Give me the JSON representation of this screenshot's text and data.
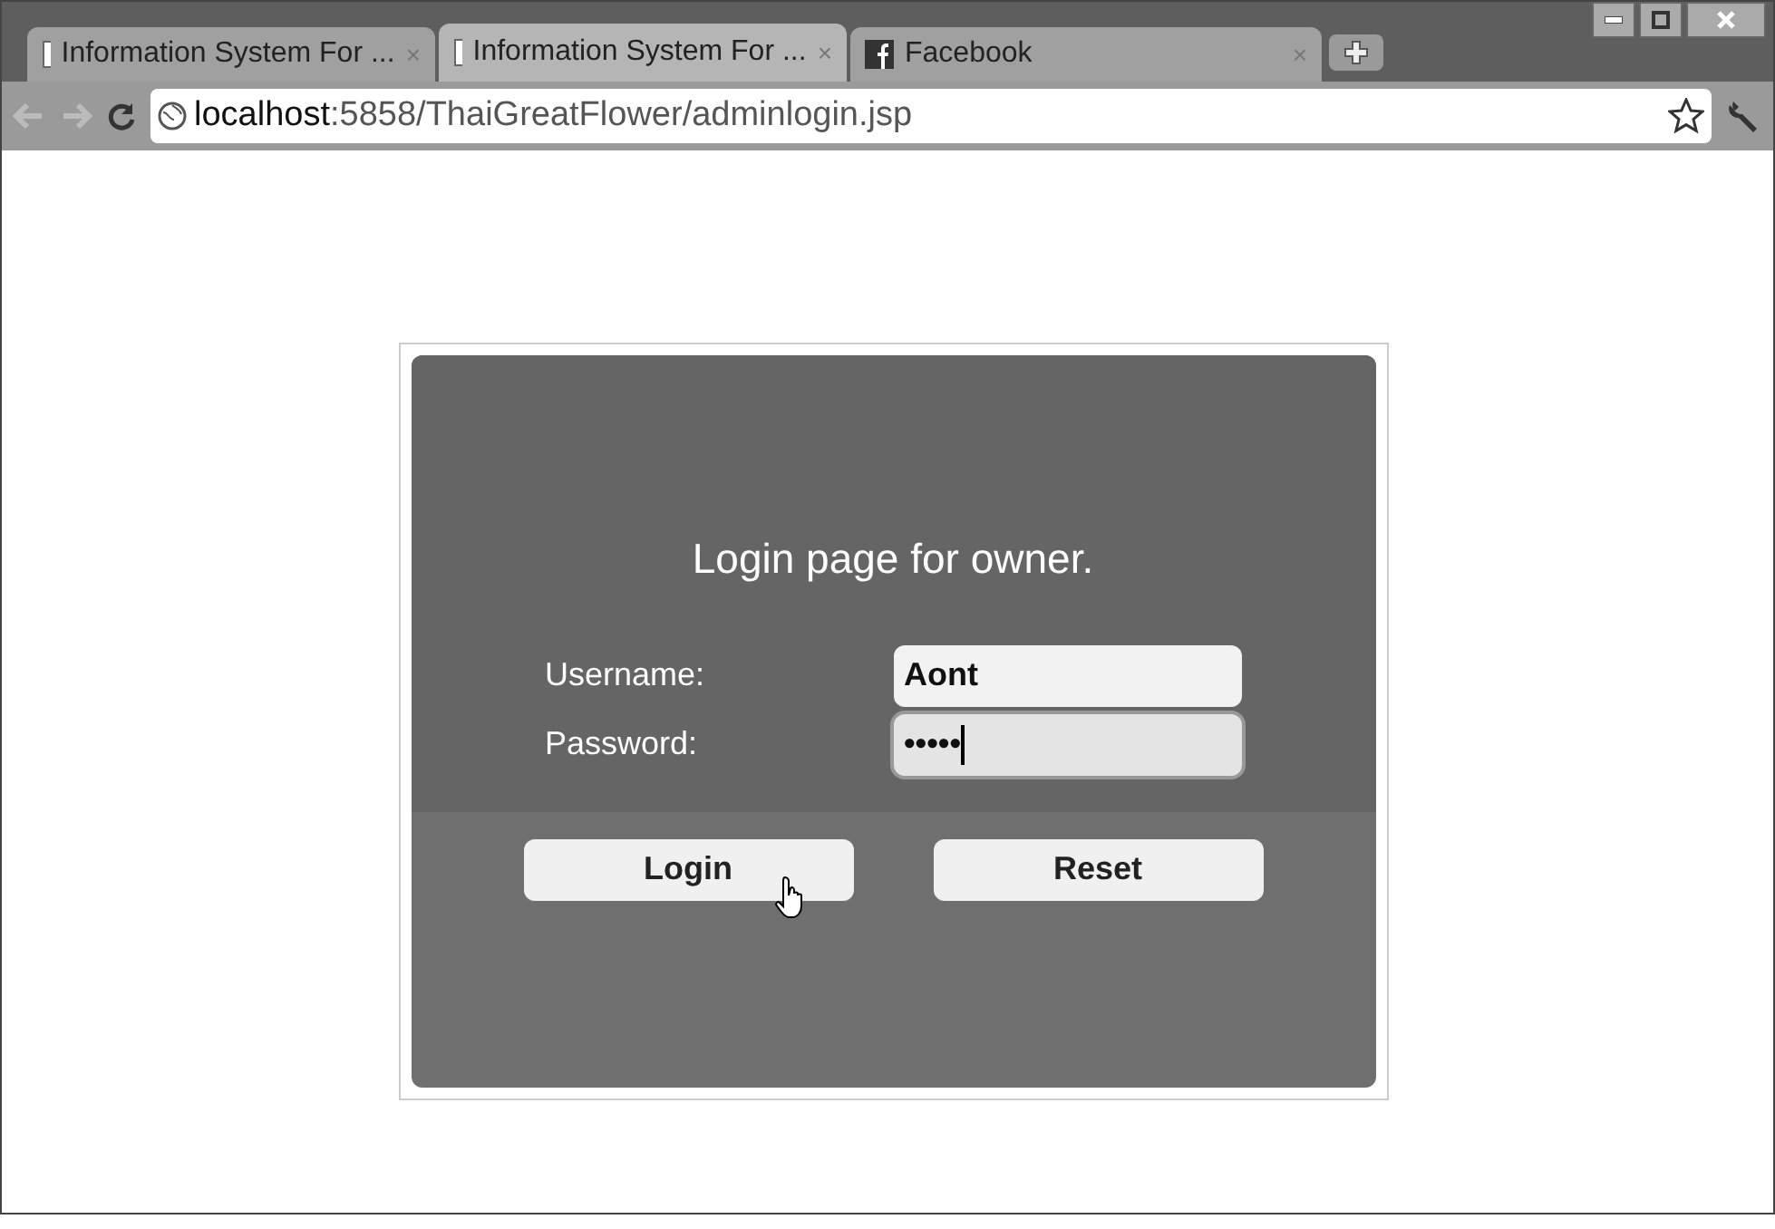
{
  "tabs": [
    {
      "title": "Information System For ...",
      "kind": "page",
      "selected": false
    },
    {
      "title": "Information System For ...",
      "kind": "page",
      "selected": true
    },
    {
      "title": "Facebook",
      "kind": "facebook",
      "selected": false
    }
  ],
  "tab_close": "×",
  "address_bar": {
    "host": "localhost",
    "rest": ":5858/ThaiGreatFlower/adminlogin.jsp"
  },
  "login": {
    "heading": "Login page for owner.",
    "fields": [
      {
        "label": "Username:",
        "value": "Aont",
        "focused": false
      },
      {
        "label": "Password:",
        "value": "•••••",
        "focused": true
      }
    ],
    "buttons": [
      "Login",
      "Reset"
    ]
  }
}
